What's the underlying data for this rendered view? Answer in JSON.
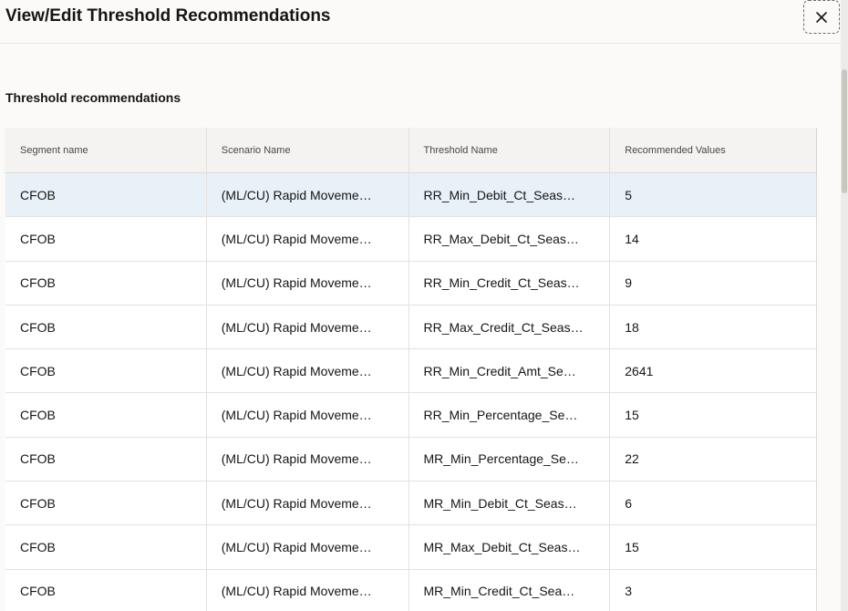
{
  "dialog": {
    "title": "View/Edit Threshold Recommendations",
    "close_icon": "close-icon"
  },
  "section": {
    "title": "Threshold recommendations"
  },
  "table": {
    "columns": [
      "Segment name",
      "Scenario Name",
      "Threshold Name",
      "Recommended Values"
    ],
    "rows": [
      [
        "CFOB",
        "(ML/CU) Rapid Moveme…",
        "RR_Min_Debit_Ct_Seas…",
        "5"
      ],
      [
        "CFOB",
        "(ML/CU) Rapid Moveme…",
        "RR_Max_Debit_Ct_Seas…",
        "14"
      ],
      [
        "CFOB",
        "(ML/CU) Rapid Moveme…",
        "RR_Min_Credit_Ct_Seas…",
        "9"
      ],
      [
        "CFOB",
        "(ML/CU) Rapid Moveme…",
        "RR_Max_Credit_Ct_Seas…",
        "18"
      ],
      [
        "CFOB",
        "(ML/CU) Rapid Moveme…",
        "RR_Min_Credit_Amt_Se…",
        "2641"
      ],
      [
        "CFOB",
        "(ML/CU) Rapid Moveme…",
        "RR_Min_Percentage_Se…",
        "15"
      ],
      [
        "CFOB",
        "(ML/CU) Rapid Moveme…",
        "MR_Min_Percentage_Se…",
        "22"
      ],
      [
        "CFOB",
        "(ML/CU) Rapid Moveme…",
        "MR_Min_Debit_Ct_Seas…",
        "6"
      ],
      [
        "CFOB",
        "(ML/CU) Rapid Moveme…",
        "MR_Max_Debit_Ct_Seas…",
        "15"
      ],
      [
        "CFOB",
        "(ML/CU) Rapid Moveme…",
        "MR_Min_Credit_Ct_Sea…",
        "3"
      ]
    ],
    "selected_row_index": 0
  },
  "colors": {
    "selected_row": "#e8f1f8",
    "header_bg": "#f4f3f1",
    "text": "#161513"
  }
}
